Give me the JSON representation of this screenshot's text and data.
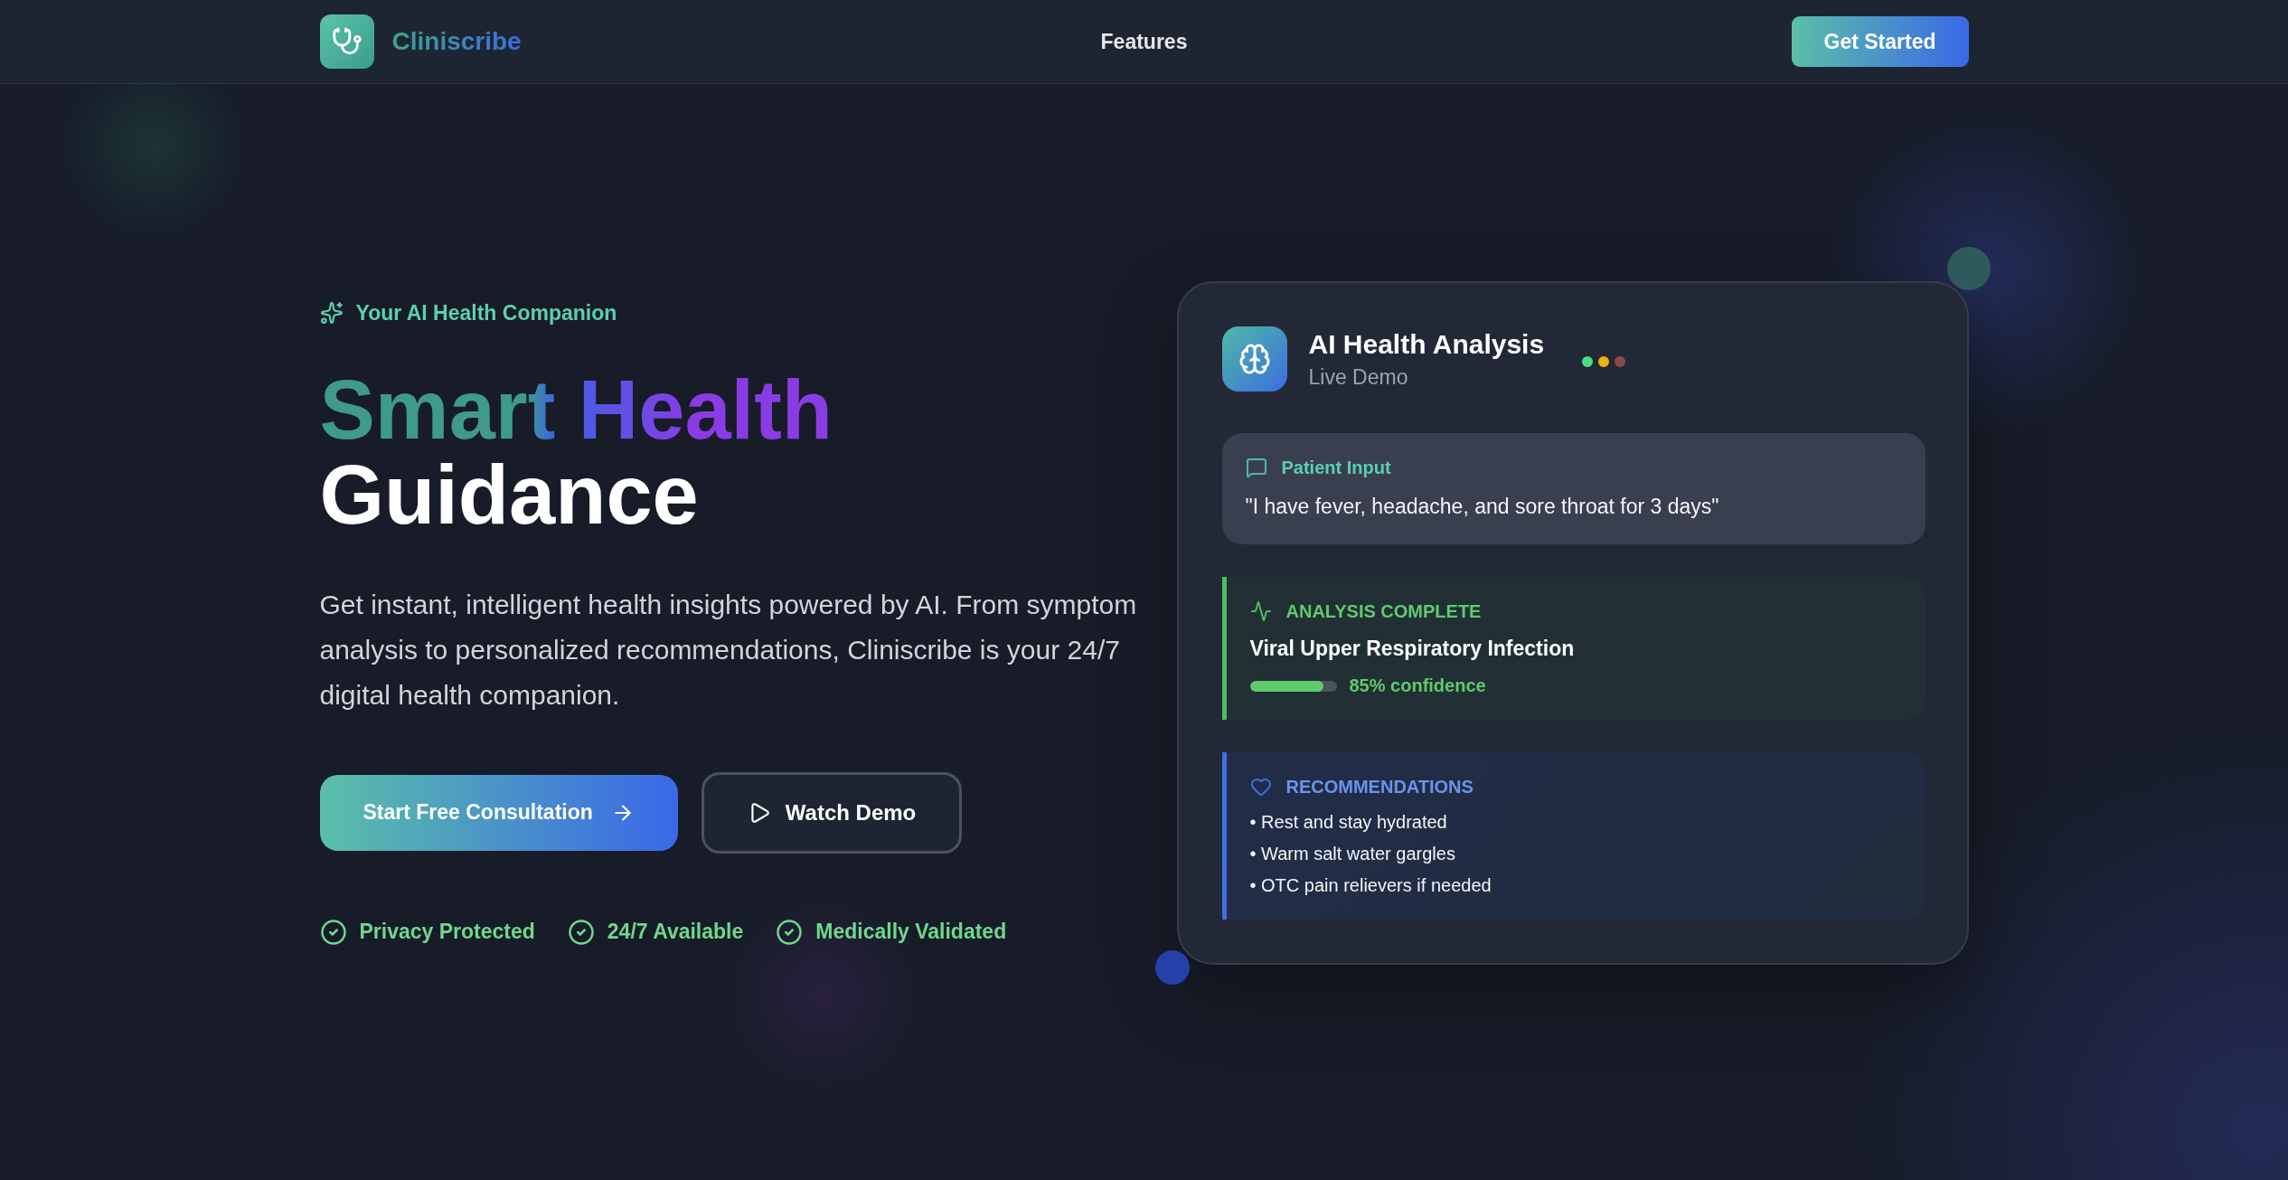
{
  "header": {
    "brand": "Cliniscribe",
    "nav": [
      {
        "label": "Features"
      }
    ],
    "cta": "Get Started"
  },
  "hero": {
    "tagline": "Your AI Health Companion",
    "headline_gradient": "Smart Health",
    "headline_plain": "Guidance",
    "description": "Get instant, intelligent health insights powered by AI. From symptom analysis to personalized recommendations, Cliniscribe is your 24/7 digital health companion.",
    "primary_button": "Start Free Consultation",
    "secondary_button": "Watch Demo",
    "badges": [
      "Privacy Protected",
      "24/7 Available",
      "Medically Validated"
    ]
  },
  "demo_card": {
    "title": "AI Health Analysis",
    "subtitle": "Live Demo",
    "status_dots": [
      {
        "color": "#4ade80"
      },
      {
        "color": "#eab308"
      },
      {
        "color": "#8b4a4a"
      }
    ],
    "patient_input": {
      "label": "Patient Input",
      "text": "\"I have fever, headache, and sore throat for 3 days\""
    },
    "analysis": {
      "label": "ANALYSIS COMPLETE",
      "diagnosis": "Viral Upper Respiratory Infection",
      "level": 0.85,
      "confidence": "85% confidence"
    },
    "recommendations": {
      "label": "RECOMMENDATIONS",
      "items": [
        "• Rest and stay hydrated",
        "• Warm salt water gargles",
        "• OTC pain relievers if needed"
      ]
    }
  }
}
